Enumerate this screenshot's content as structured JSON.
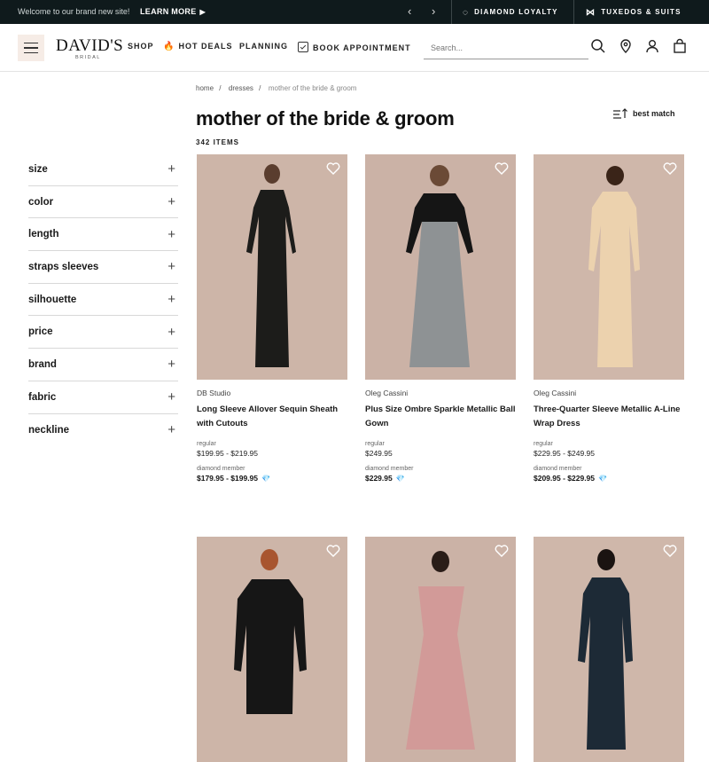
{
  "topbar": {
    "welcome": "Welcome to our brand new site!",
    "learn_more": "LEARN MORE",
    "promo1": "DIAMOND LOYALTY",
    "promo2": "TUXEDOS & SUITS"
  },
  "header": {
    "logo": "DAVID'S",
    "logo_sub": "BRIDAL",
    "nav": [
      "SHOP",
      "HOT DEALS",
      "PLANNING",
      "BOOK APPOINTMENT"
    ],
    "search_placeholder": "Search..."
  },
  "breadcrumb": [
    "home",
    "dresses",
    "mother of the bride & groom"
  ],
  "page": {
    "title": "mother of the bride & groom",
    "count": "342 ITEMS",
    "sort": "best match"
  },
  "filters": [
    "size",
    "color",
    "length",
    "straps sleeves",
    "silhouette",
    "price",
    "brand",
    "fabric",
    "neckline"
  ],
  "products": [
    {
      "brand": "DB Studio",
      "name": "Long Sleeve Allover Sequin Sheath with Cutouts",
      "regular_label": "regular",
      "regular": "$199.95 - $219.95",
      "member_label": "diamond member",
      "member": "$179.95 - $199.95",
      "bg": "#cdb5a8",
      "dress": "#1c1c1a"
    },
    {
      "brand": "Oleg Cassini",
      "name": "Plus Size Ombre Sparkle Metallic Ball Gown",
      "regular_label": "regular",
      "regular": "$249.95",
      "member_label": "diamond member",
      "member": "$229.95",
      "bg": "#cbb2a6",
      "dress": "#8e9294"
    },
    {
      "brand": "Oleg Cassini",
      "name": "Three-Quarter Sleeve Metallic A-Line Wrap Dress",
      "regular_label": "regular",
      "regular": "$229.95 - $249.95",
      "member_label": "diamond member",
      "member": "$209.95 - $229.95",
      "bg": "#cfb7aa",
      "dress": "#ecd2ae"
    },
    {
      "bg": "#cdb5a8",
      "dress": "#161616"
    },
    {
      "bg": "#cbb2a6",
      "dress": "#d29a98"
    },
    {
      "bg": "#cfb7aa",
      "dress": "#1d2a36"
    }
  ]
}
